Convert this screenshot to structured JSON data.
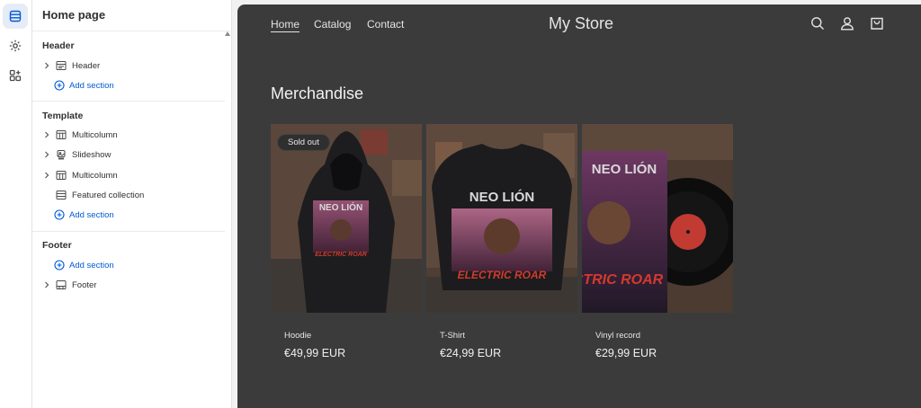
{
  "rail": {
    "items": [
      {
        "name": "sections-icon",
        "active": true
      },
      {
        "name": "settings-icon",
        "active": false
      },
      {
        "name": "apps-icon",
        "active": false
      }
    ]
  },
  "sidebar": {
    "title": "Home page",
    "groups": {
      "header": {
        "label": "Header",
        "items": [
          {
            "label": "Header",
            "icon": "header-layout-icon"
          }
        ],
        "add_label": "Add section"
      },
      "template": {
        "label": "Template",
        "items": [
          {
            "label": "Multicolumn",
            "icon": "multicolumn-icon"
          },
          {
            "label": "Slideshow",
            "icon": "slideshow-icon"
          },
          {
            "label": "Multicolumn",
            "icon": "multicolumn-icon"
          },
          {
            "label": "Featured collection",
            "icon": "collection-icon"
          }
        ],
        "add_label": "Add section"
      },
      "footer": {
        "label": "Footer",
        "add_label": "Add section",
        "items": [
          {
            "label": "Footer",
            "icon": "footer-layout-icon"
          }
        ]
      }
    }
  },
  "preview": {
    "nav": [
      {
        "label": "Home",
        "active": true
      },
      {
        "label": "Catalog",
        "active": false
      },
      {
        "label": "Contact",
        "active": false
      }
    ],
    "store_name": "My Store",
    "header_icons": [
      "search-icon",
      "account-icon",
      "cart-icon"
    ],
    "section_title": "Merchandise",
    "products": [
      {
        "name": "Hoodie",
        "price": "€49,99 EUR",
        "badge": "Sold out",
        "image_text_top": "NEO LIÓN",
        "image_text_bottom": "ELECTRIC ROAR"
      },
      {
        "name": "T-Shirt",
        "price": "€24,99 EUR",
        "badge": "",
        "image_text_top": "NEO LIÓN",
        "image_text_bottom": "ELECTRIC ROAR"
      },
      {
        "name": "Vinyl record",
        "price": "€29,99 EUR",
        "badge": "",
        "image_text_top": "NEO LIÓN",
        "image_text_bottom": "CTRIC ROAR"
      }
    ]
  },
  "colors": {
    "accent": "#005bd3",
    "preview_bg": "#3b3b3b",
    "sidebar_bg": "#ffffff"
  }
}
